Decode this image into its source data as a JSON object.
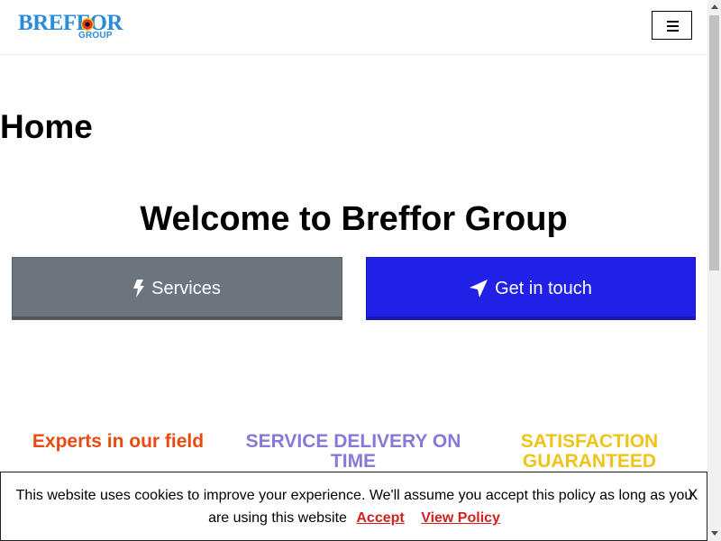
{
  "header": {
    "logo_text": "BREFFOR",
    "logo_sub": "GROUP",
    "menu_icon": "hamburger-menu-icon"
  },
  "main": {
    "page_title": "Home",
    "welcome": "Welcome to Breffor Group",
    "buttons": [
      {
        "label": "Services",
        "icon": "bolt-icon",
        "color": "#6c757d"
      },
      {
        "label": "Get in touch",
        "icon": "location-arrow-icon",
        "color": "#2020e6"
      }
    ],
    "features": [
      {
        "title": "Experts in our field",
        "color": "#ea4a12"
      },
      {
        "title": "SERVICE DELIVERY ON TIME",
        "color": "#8a78d8"
      },
      {
        "title": "SATISFACTION GUARANTEED",
        "color": "#f0c31a"
      }
    ]
  },
  "cookie": {
    "message": "This website uses cookies to improve your experience. We'll assume you accept this policy as long as you are using this website",
    "accept_label": "Accept",
    "policy_label": "View Policy",
    "close_label": "X",
    "link_color": "#d21f1f"
  }
}
